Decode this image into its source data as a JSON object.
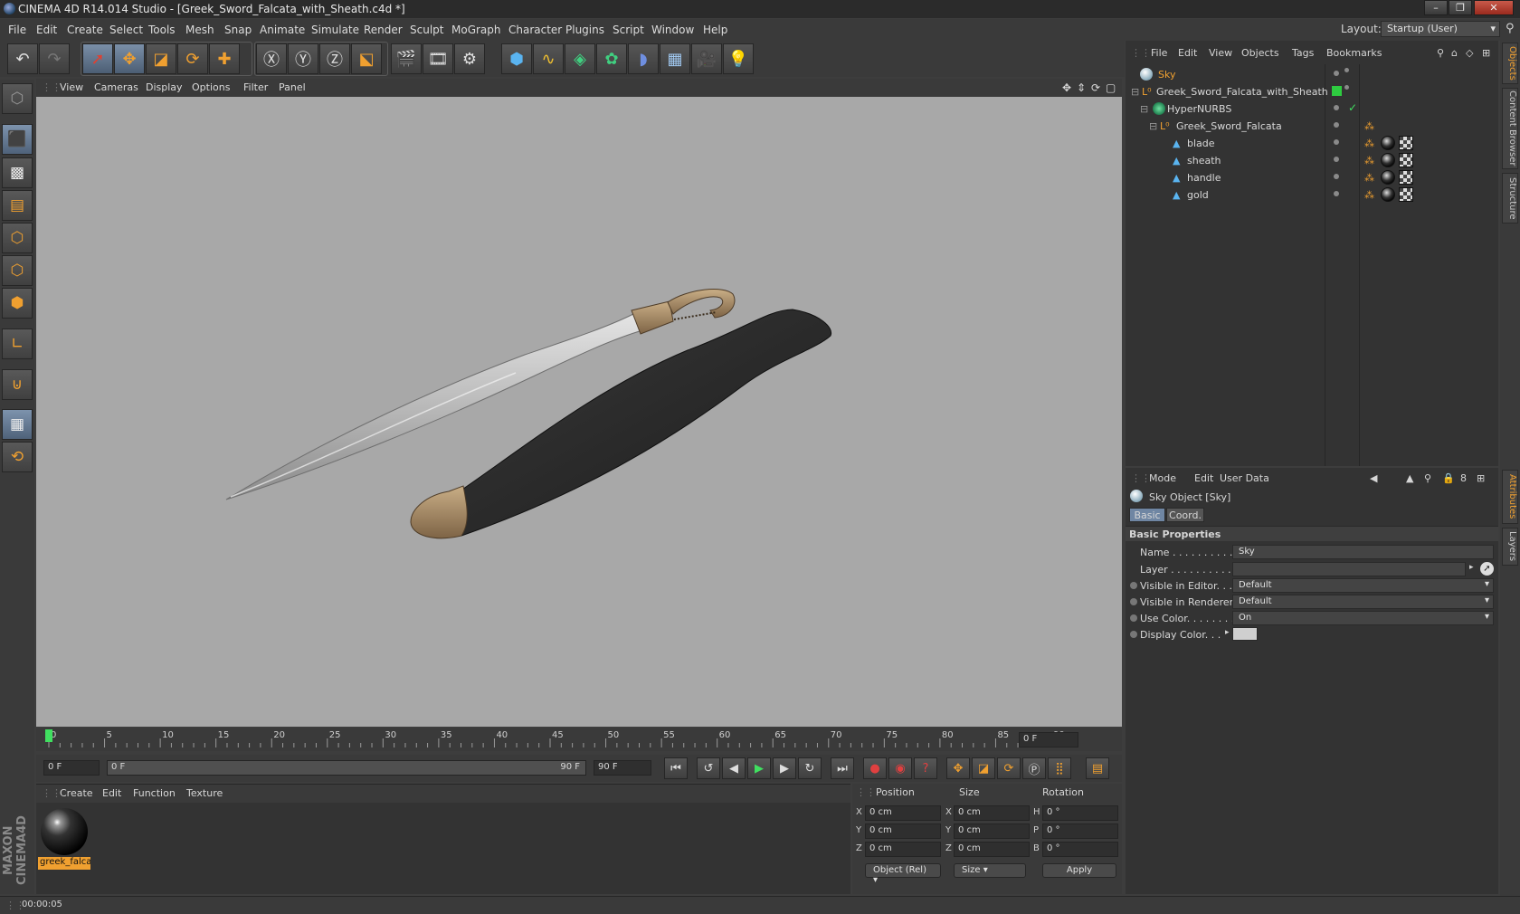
{
  "titlebar": {
    "title": "CINEMA 4D R14.014 Studio - [Greek_Sword_Falcata_with_Sheath.c4d *]"
  },
  "menubar": {
    "items": [
      "File",
      "Edit",
      "Create",
      "Select",
      "Tools",
      "Mesh",
      "Snap",
      "Animate",
      "Simulate",
      "Render",
      "Sculpt",
      "MoGraph",
      "Character",
      "Plugins",
      "Script",
      "Window",
      "Help"
    ],
    "layout_label": "Layout:",
    "layout_value": "Startup (User)"
  },
  "viewport": {
    "menu": [
      "View",
      "Cameras",
      "Display",
      "Options",
      "Filter",
      "Panel"
    ],
    "background": "#a8a8a8"
  },
  "timeline": {
    "ticks": [
      "0",
      "5",
      "10",
      "15",
      "20",
      "25",
      "30",
      "35",
      "40",
      "45",
      "50",
      "55",
      "60",
      "65",
      "70",
      "75",
      "80",
      "85",
      "90"
    ],
    "current_frame_field": "0 F"
  },
  "playbar": {
    "start_field": "0 F",
    "slider_start": "0 F",
    "slider_end": "90 F",
    "end_field": "90 F"
  },
  "material_manager": {
    "menu": [
      "Create",
      "Edit",
      "Function",
      "Texture"
    ],
    "materials": [
      {
        "name": "greek_falca"
      }
    ]
  },
  "coord_manager": {
    "headers": [
      "Position",
      "Size",
      "Rotation"
    ],
    "rows": [
      {
        "axis": "X",
        "pos": "0 cm",
        "size_axis": "X",
        "size": "0 cm",
        "rot_axis": "H",
        "rot": "0 °"
      },
      {
        "axis": "Y",
        "pos": "0 cm",
        "size_axis": "Y",
        "size": "0 cm",
        "rot_axis": "P",
        "rot": "0 °"
      },
      {
        "axis": "Z",
        "pos": "0 cm",
        "size_axis": "Z",
        "size": "0 cm",
        "rot_axis": "B",
        "rot": "0 °"
      }
    ],
    "mode_dropdown": "Object (Rel)",
    "size_dropdown": "Size",
    "apply_label": "Apply"
  },
  "status": {
    "time": "00:00:05"
  },
  "object_manager": {
    "menu": [
      "File",
      "Edit",
      "View",
      "Objects",
      "Tags",
      "Bookmarks"
    ],
    "objects": [
      {
        "name": "Sky",
        "level": 0,
        "color": "#f0a030"
      },
      {
        "name": "Greek_Sword_Falcata_with_Sheath",
        "level": 0,
        "color": "#d6d6d6"
      },
      {
        "name": "HyperNURBS",
        "level": 1,
        "color": "#d6d6d6"
      },
      {
        "name": "Greek_Sword_Falcata",
        "level": 2,
        "color": "#d6d6d6"
      },
      {
        "name": "blade",
        "level": 3,
        "color": "#d6d6d6"
      },
      {
        "name": "sheath",
        "level": 3,
        "color": "#d6d6d6"
      },
      {
        "name": "handle",
        "level": 3,
        "color": "#d6d6d6"
      },
      {
        "name": "gold",
        "level": 3,
        "color": "#d6d6d6"
      }
    ]
  },
  "attribute_manager": {
    "menu": [
      "Mode",
      "Edit",
      "User Data"
    ],
    "object_title": "Sky Object [Sky]",
    "tabs": [
      "Basic",
      "Coord."
    ],
    "section": "Basic Properties",
    "fields": [
      {
        "label": "Name . . . . . . . . . . .",
        "value": "Sky"
      },
      {
        "label": "Layer . . . . . . . . . . .",
        "value": ""
      },
      {
        "label": "Visible in Editor. . .",
        "value": "Default"
      },
      {
        "label": "Visible in Renderer",
        "value": "Default"
      },
      {
        "label": "Use Color. . . . . . . .",
        "value": "On"
      },
      {
        "label": "Display Color. . .",
        "value": ""
      }
    ]
  },
  "right_tabs": [
    "Objects",
    "Content Browser",
    "Structure",
    "Attributes",
    "Layers"
  ],
  "colors": {
    "accent": "#f0a030",
    "selected_tab": "#6f86a3"
  }
}
